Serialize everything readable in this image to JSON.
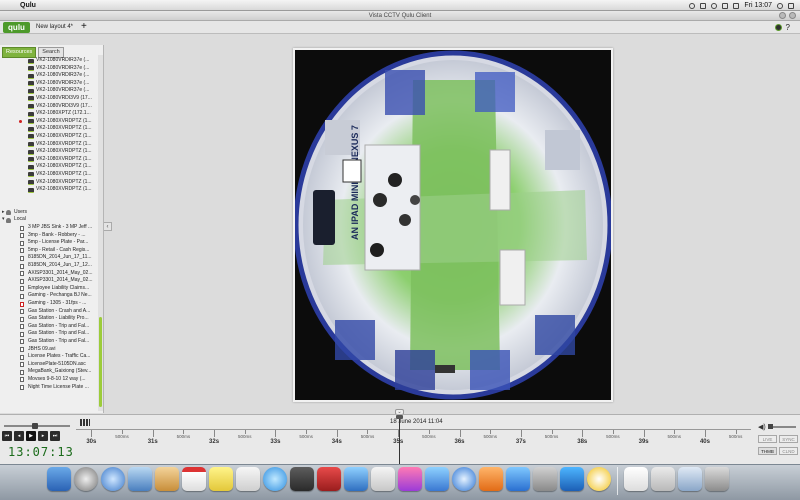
{
  "menubar": {
    "app_name": "Qulu",
    "time": "Fri 13:07"
  },
  "titlebar": {
    "title": "Vista CCTV Qulu Client"
  },
  "toolbar": {
    "logo": "qulu",
    "layout_tab": "New layout 4*",
    "add_label": "+",
    "help_label": "?"
  },
  "sidebar": {
    "tabs": [
      "Resources",
      "Search"
    ],
    "items": [
      {
        "label": "VK2-1080VRDIR37e (...",
        "kind": "camera",
        "depth": 2
      },
      {
        "label": "VK2-1080VRDIR37e (...",
        "kind": "camera",
        "depth": 2
      },
      {
        "label": "VK2-1080VRDIR37e (...",
        "kind": "camera",
        "depth": 2
      },
      {
        "label": "VK2-1080VRDIR37e (...",
        "kind": "camera",
        "depth": 2
      },
      {
        "label": "VK2-1080VRDIR37e (...",
        "kind": "camera",
        "depth": 2
      },
      {
        "label": "VK2-1080VRDI3V9 (17...",
        "kind": "camera",
        "depth": 2
      },
      {
        "label": "VK2-1080VRDI3V9 (17...",
        "kind": "camera",
        "depth": 2
      },
      {
        "label": "VK2-1080XPTZ (172.1...",
        "kind": "camera",
        "depth": 2
      },
      {
        "label": "VK2-1080XVRDPTZ (1...",
        "kind": "camera",
        "depth": 2,
        "recording": true
      },
      {
        "label": "VK2-1080XVRDPTZ (1...",
        "kind": "camera",
        "depth": 2
      },
      {
        "label": "VK2-1080XVRDPTZ (1...",
        "kind": "camera",
        "depth": 2
      },
      {
        "label": "VK2-1080XVRDPTZ (1...",
        "kind": "camera",
        "depth": 2
      },
      {
        "label": "VK2-1080XVRDPTZ (1...",
        "kind": "camera",
        "depth": 2
      },
      {
        "label": "VK2-1080XVRDPTZ (1...",
        "kind": "camera",
        "depth": 2
      },
      {
        "label": "VK2-1080XVRDPTZ (1...",
        "kind": "camera",
        "depth": 2
      },
      {
        "label": "VK2-1080XVRDPTZ (1...",
        "kind": "camera",
        "depth": 2
      },
      {
        "label": "VK2-1080XVRDPTZ (1...",
        "kind": "camera",
        "depth": 2
      },
      {
        "label": "VK2-1080XVRDPTZ (1...",
        "kind": "camera",
        "depth": 2
      },
      {
        "label": "",
        "kind": "spacer",
        "depth": 0
      },
      {
        "label": "",
        "kind": "spacer",
        "depth": 0
      },
      {
        "label": "Users",
        "kind": "group",
        "depth": 0,
        "arrow": "▸"
      },
      {
        "label": "Local",
        "kind": "group",
        "depth": 0,
        "arrow": "▾"
      },
      {
        "label": "3 MP JBS Sink - 3 MP Jeff ...",
        "kind": "file",
        "depth": 1
      },
      {
        "label": "3mp - Bank - Robbery - ...",
        "kind": "file",
        "depth": 1
      },
      {
        "label": "5mp - License Plate - Par...",
        "kind": "file",
        "depth": 1
      },
      {
        "label": "5mp - Retail - Cash Regis...",
        "kind": "file",
        "depth": 1
      },
      {
        "label": "8185DN_2014_Jun_17_11...",
        "kind": "file",
        "depth": 1
      },
      {
        "label": "8185DN_2014_Jun_17_12...",
        "kind": "file",
        "depth": 1
      },
      {
        "label": "AXISP3301_2014_May_02...",
        "kind": "file",
        "depth": 1
      },
      {
        "label": "AXISP3301_2014_May_02...",
        "kind": "file",
        "depth": 1
      },
      {
        "label": "Employee Liability Claims...",
        "kind": "file",
        "depth": 1
      },
      {
        "label": "Gaming - Pechanga BJ Ne...",
        "kind": "file",
        "depth": 1
      },
      {
        "label": "Gaming - 1305 - 31fps - ...",
        "kind": "file-red",
        "depth": 1
      },
      {
        "label": "Gas Station - Crash and A...",
        "kind": "file",
        "depth": 1
      },
      {
        "label": "Gas Station - Liability Pro...",
        "kind": "file",
        "depth": 1
      },
      {
        "label": "Gas Station - Trip and Fal...",
        "kind": "file",
        "depth": 1
      },
      {
        "label": "Gas Station - Trip and Fal...",
        "kind": "file",
        "depth": 1
      },
      {
        "label": "Gas Station - Trip and Fal...",
        "kind": "file",
        "depth": 1
      },
      {
        "label": "JBHS 09.avi",
        "kind": "file",
        "depth": 1
      },
      {
        "label": "License Plates - Traffic Ca...",
        "kind": "file",
        "depth": 1
      },
      {
        "label": "LicensePlate-5105DN.asc",
        "kind": "file",
        "depth": 1
      },
      {
        "label": "MegaBank_Gaixiong (Stev...",
        "kind": "file",
        "depth": 1
      },
      {
        "label": "Movses 9-8-10 12 way (...",
        "kind": "file",
        "depth": 1
      },
      {
        "label": "Night Time License Plate ...",
        "kind": "file",
        "depth": 1
      }
    ]
  },
  "timeline": {
    "clock": "13:07:13",
    "date_marker": "18 June 2014 11:04",
    "labels": [
      {
        "text": "30s",
        "major": true
      },
      {
        "text": "500ms",
        "major": false
      },
      {
        "text": "31s",
        "major": true
      },
      {
        "text": "500ms",
        "major": false
      },
      {
        "text": "32s",
        "major": true
      },
      {
        "text": "500ms",
        "major": false
      },
      {
        "text": "33s",
        "major": true
      },
      {
        "text": "500ms",
        "major": false
      },
      {
        "text": "34s",
        "major": true
      },
      {
        "text": "500ms",
        "major": false
      },
      {
        "text": "35s",
        "major": true
      },
      {
        "text": "500ms",
        "major": false
      },
      {
        "text": "36s",
        "major": true
      },
      {
        "text": "500ms",
        "major": false
      },
      {
        "text": "37s",
        "major": true
      },
      {
        "text": "500ms",
        "major": false
      },
      {
        "text": "38s",
        "major": true
      },
      {
        "text": "500ms",
        "major": false
      },
      {
        "text": "39s",
        "major": true
      },
      {
        "text": "500ms",
        "major": false
      },
      {
        "text": "40s",
        "major": true
      },
      {
        "text": "500ms",
        "major": false
      }
    ],
    "right_buttons": [
      "LIVE",
      "SYNC",
      "THMB",
      "CLND"
    ],
    "right_active": [
      "THMB"
    ]
  },
  "video": {
    "banner_text": "AN IPAD MINI OR NEXUS 7"
  }
}
